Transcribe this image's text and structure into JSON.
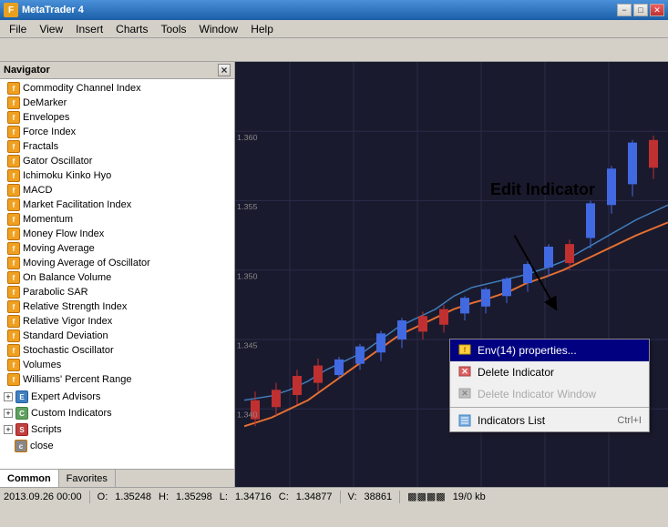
{
  "titlebar": {
    "icon": "F",
    "title": "MetaTrader 4",
    "minimize_label": "−",
    "maximize_label": "□",
    "close_label": "✕"
  },
  "menubar": {
    "items": [
      {
        "label": "File"
      },
      {
        "label": "View"
      },
      {
        "label": "Insert"
      },
      {
        "label": "Charts"
      },
      {
        "label": "Tools"
      },
      {
        "label": "Window"
      },
      {
        "label": "Help"
      }
    ]
  },
  "navigator": {
    "title": "Navigator",
    "indicators": [
      "Commodity Channel Index",
      "DeMarker",
      "Envelopes",
      "Force Index",
      "Fractals",
      "Gator Oscillator",
      "Ichimoku Kinko Hyo",
      "MACD",
      "Market Facilitation Index",
      "Momentum",
      "Money Flow Index",
      "Moving Average",
      "Moving Average of Oscillator",
      "On Balance Volume",
      "Parabolic SAR",
      "Relative Strength Index",
      "Relative Vigor Index",
      "Standard Deviation",
      "Stochastic Oscillator",
      "Volumes",
      "Williams' Percent Range"
    ],
    "sections": [
      {
        "label": "Expert Advisors",
        "icon": "EA"
      },
      {
        "label": "Custom Indicators",
        "icon": "CI"
      },
      {
        "label": "Scripts",
        "icon": "S"
      }
    ],
    "close_label": "×"
  },
  "tabs": [
    {
      "label": "Common",
      "active": true
    },
    {
      "label": "Favorites",
      "active": false
    }
  ],
  "context_menu": {
    "items": [
      {
        "label": "Env(14) properties...",
        "icon": "properties",
        "highlighted": true,
        "disabled": false,
        "shortcut": ""
      },
      {
        "label": "Delete Indicator",
        "icon": "delete",
        "highlighted": false,
        "disabled": false,
        "shortcut": ""
      },
      {
        "label": "Delete Indicator Window",
        "icon": "delete_window",
        "highlighted": false,
        "disabled": true,
        "shortcut": ""
      },
      {
        "label": "Indicators List",
        "icon": "list",
        "highlighted": false,
        "disabled": false,
        "shortcut": "Ctrl+I"
      }
    ]
  },
  "edit_indicator_label": "Edit Indicator",
  "statusbar": {
    "date": "2013.09.26 00:00",
    "open_label": "O:",
    "open_val": "1.35248",
    "high_label": "H:",
    "high_val": "1.35298",
    "low_label": "L:",
    "low_val": "1.34716",
    "close_label": "C:",
    "close_val": "1.34877",
    "volume_label": "V:",
    "volume_val": "38861",
    "bars_label": "19/0 kb"
  },
  "colors": {
    "bull_candle": "#4169e1",
    "bear_candle": "#c03030",
    "chart_bg": "#1a1a2e",
    "ma_line": "#e87030",
    "ma_line2": "#4080c0",
    "grid": "#2a2a4a"
  }
}
